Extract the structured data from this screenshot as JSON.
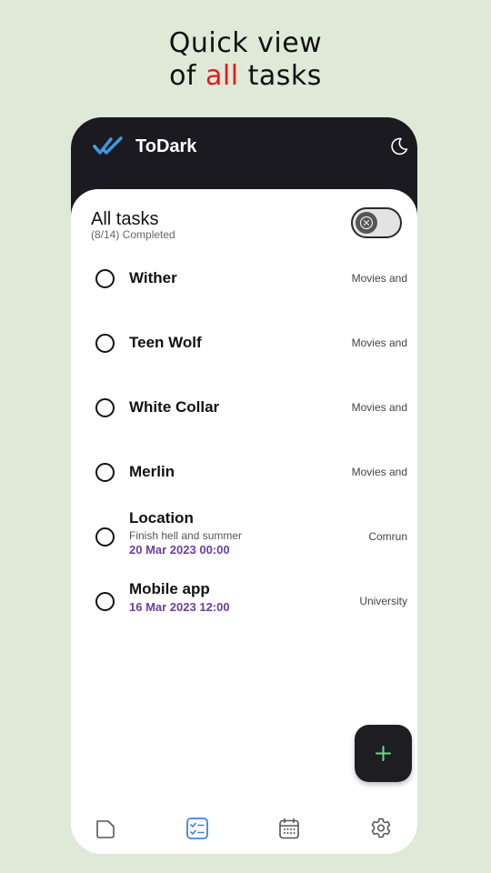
{
  "promo": {
    "line1": "Quick view",
    "line2_prefix": "of ",
    "line2_accent": "all",
    "line2_suffix": " tasks",
    "accent_color": "#e31b1b"
  },
  "app": {
    "title": "ToDark",
    "theme_icon": "moon-icon",
    "logo_icon": "double-check-logo"
  },
  "list": {
    "title": "All tasks",
    "subtitle": "(8/14) Completed",
    "toggle_icon": "x-circle-icon"
  },
  "tasks": [
    {
      "title": "Wither",
      "category": "Movies and"
    },
    {
      "title": "Teen Wolf",
      "category": "Movies and"
    },
    {
      "title": "White Collar",
      "category": "Movies and"
    },
    {
      "title": "Merlin",
      "category": "Movies and"
    },
    {
      "title": "Location",
      "note": "Finish hell and summer",
      "date": "20 Mar 2023 00:00",
      "category": "Comrun"
    },
    {
      "title": "Mobile app",
      "date": "16 Mar 2023 12:00",
      "category": "University"
    }
  ],
  "fab": {
    "icon": "plus-icon",
    "icon_color": "#5fe08a"
  },
  "nav": [
    {
      "icon": "folder-icon",
      "active": false
    },
    {
      "icon": "checklist-icon",
      "active": true
    },
    {
      "icon": "calendar-icon",
      "active": false
    },
    {
      "icon": "gear-icon",
      "active": false
    }
  ],
  "colors": {
    "background": "#dfe9d8",
    "app_bar": "#1b1a20",
    "active_nav": "#3d83e0",
    "date_text": "#6a3fa0"
  }
}
